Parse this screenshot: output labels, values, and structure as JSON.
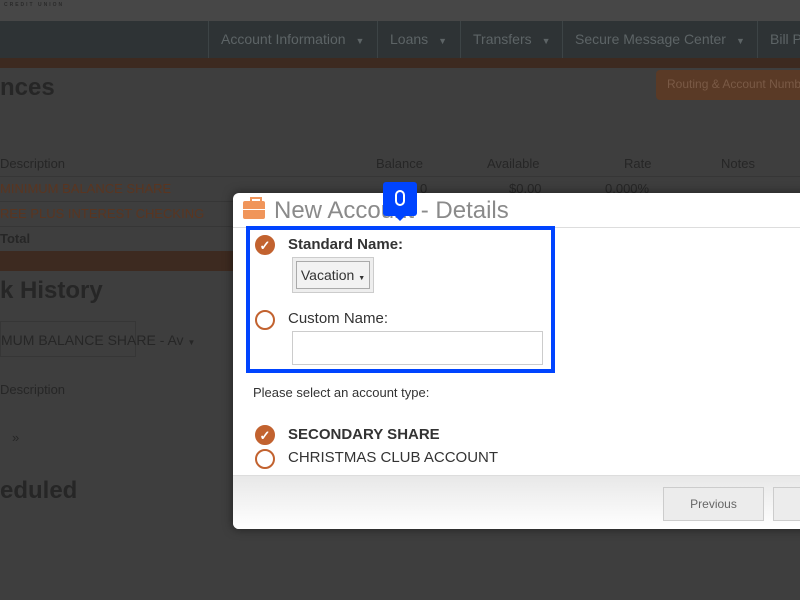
{
  "brand": {
    "logo_sub": "CREDIT UNION"
  },
  "nav": {
    "items": [
      "Account Information",
      "Loans",
      "Transfers",
      "Secure Message Center",
      "Bill P"
    ]
  },
  "page": {
    "balances_heading": "nces",
    "routing_button": "Routing & Account Numb",
    "table_headers": [
      "Description",
      "Balance",
      "Available",
      "Rate",
      "Notes"
    ],
    "rows": [
      {
        "name": "MINIMUM BALANCE SHARE",
        "balance": "0",
        "available": "$0.00",
        "rate": "0.000%"
      },
      {
        "name": "REE PLUS INTEREST CHECKING"
      }
    ],
    "total_label": "Total",
    "history_heading": "k History",
    "history_select": "MUM BALANCE SHARE - Av",
    "history_col": "Description",
    "pager_next": "»",
    "scheduled_heading": "eduled"
  },
  "modal": {
    "title": "New Account - Details",
    "standard_name_label": "Standard Name:",
    "standard_name_value": "Vacation",
    "custom_name_label": "Custom Name:",
    "custom_name_value": "",
    "account_type_prompt": "Please select an account type:",
    "account_types": [
      {
        "label": "SECONDARY SHARE",
        "selected": true
      },
      {
        "label": "CHRISTMAS CLUB ACCOUNT",
        "selected": false
      }
    ],
    "previous_button": "Previous"
  },
  "colors": {
    "accent": "#c2622f",
    "highlight": "#0044ff"
  }
}
